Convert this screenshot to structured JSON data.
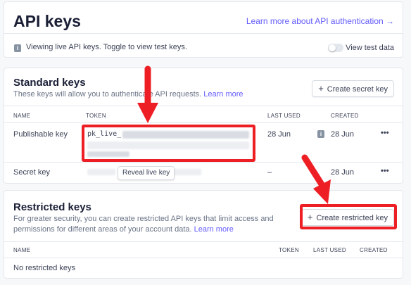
{
  "header": {
    "title": "API keys",
    "learn_more_link": "Learn more about API authentication →",
    "notice_text": "Viewing live API keys. Toggle to view test keys.",
    "toggle_label": "View test data"
  },
  "standard": {
    "title": "Standard keys",
    "description": "These keys will allow you to authenticate API requests.",
    "learn_more": "Learn more",
    "create_button": "Create secret key",
    "columns": {
      "name": "NAME",
      "token": "TOKEN",
      "last_used": "LAST USED",
      "created": "CREATED"
    },
    "rows": [
      {
        "name": "Publishable key",
        "token_prefix": "pk_live_",
        "last_used": "28 Jun",
        "created": "28 Jun"
      },
      {
        "name": "Secret key",
        "reveal_button": "Reveal live key",
        "last_used": "–",
        "created": "28 Jun"
      }
    ],
    "more_glyph": "•••"
  },
  "restricted": {
    "title": "Restricted keys",
    "description": "For greater security, you can create restricted API keys that limit access and permissions for different areas of your account data.",
    "learn_more": "Learn more",
    "create_button": "Create restricted key",
    "columns": {
      "name": "NAME",
      "token": "TOKEN",
      "last_used": "LAST USED",
      "created": "CREATED"
    },
    "empty_text": "No restricted keys"
  },
  "icons": {
    "info": "info-icon",
    "plus": "plus-icon",
    "more": "more-horizontal-icon",
    "arrow": "red-arrow-icon"
  },
  "colors": {
    "accent": "#635bff",
    "annotation_red": "#ee1f24",
    "border": "#e3e8ee"
  }
}
